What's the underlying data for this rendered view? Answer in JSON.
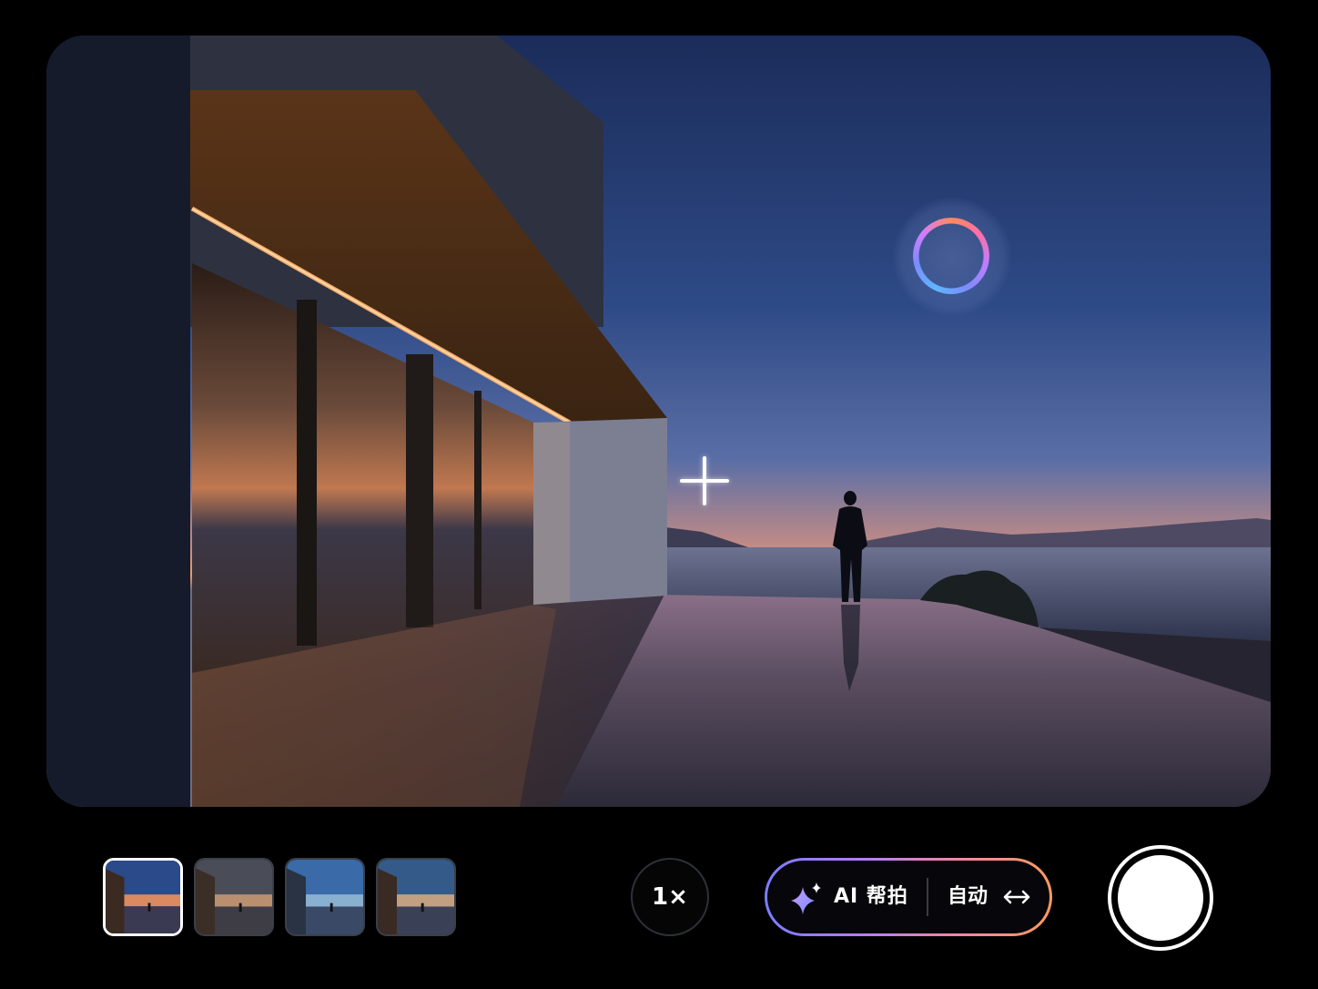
{
  "camera": {
    "zoom_label": "1×",
    "ai_assist": {
      "label": "AI 帮拍",
      "mode_label": "自动",
      "accent_gradient": [
        "#7a7cff",
        "#b07cff",
        "#f08aa0",
        "#ff9a5c"
      ]
    },
    "thumbnails": [
      {
        "name": "preset-1",
        "selected": true
      },
      {
        "name": "preset-2",
        "selected": false
      },
      {
        "name": "preset-3",
        "selected": false
      },
      {
        "name": "preset-4",
        "selected": false
      }
    ],
    "icons": {
      "focus": "crosshair-icon",
      "ai_ring": "ai-ring-icon",
      "sparkle": "sparkle-icon",
      "swap": "swap-arrows-icon"
    }
  }
}
